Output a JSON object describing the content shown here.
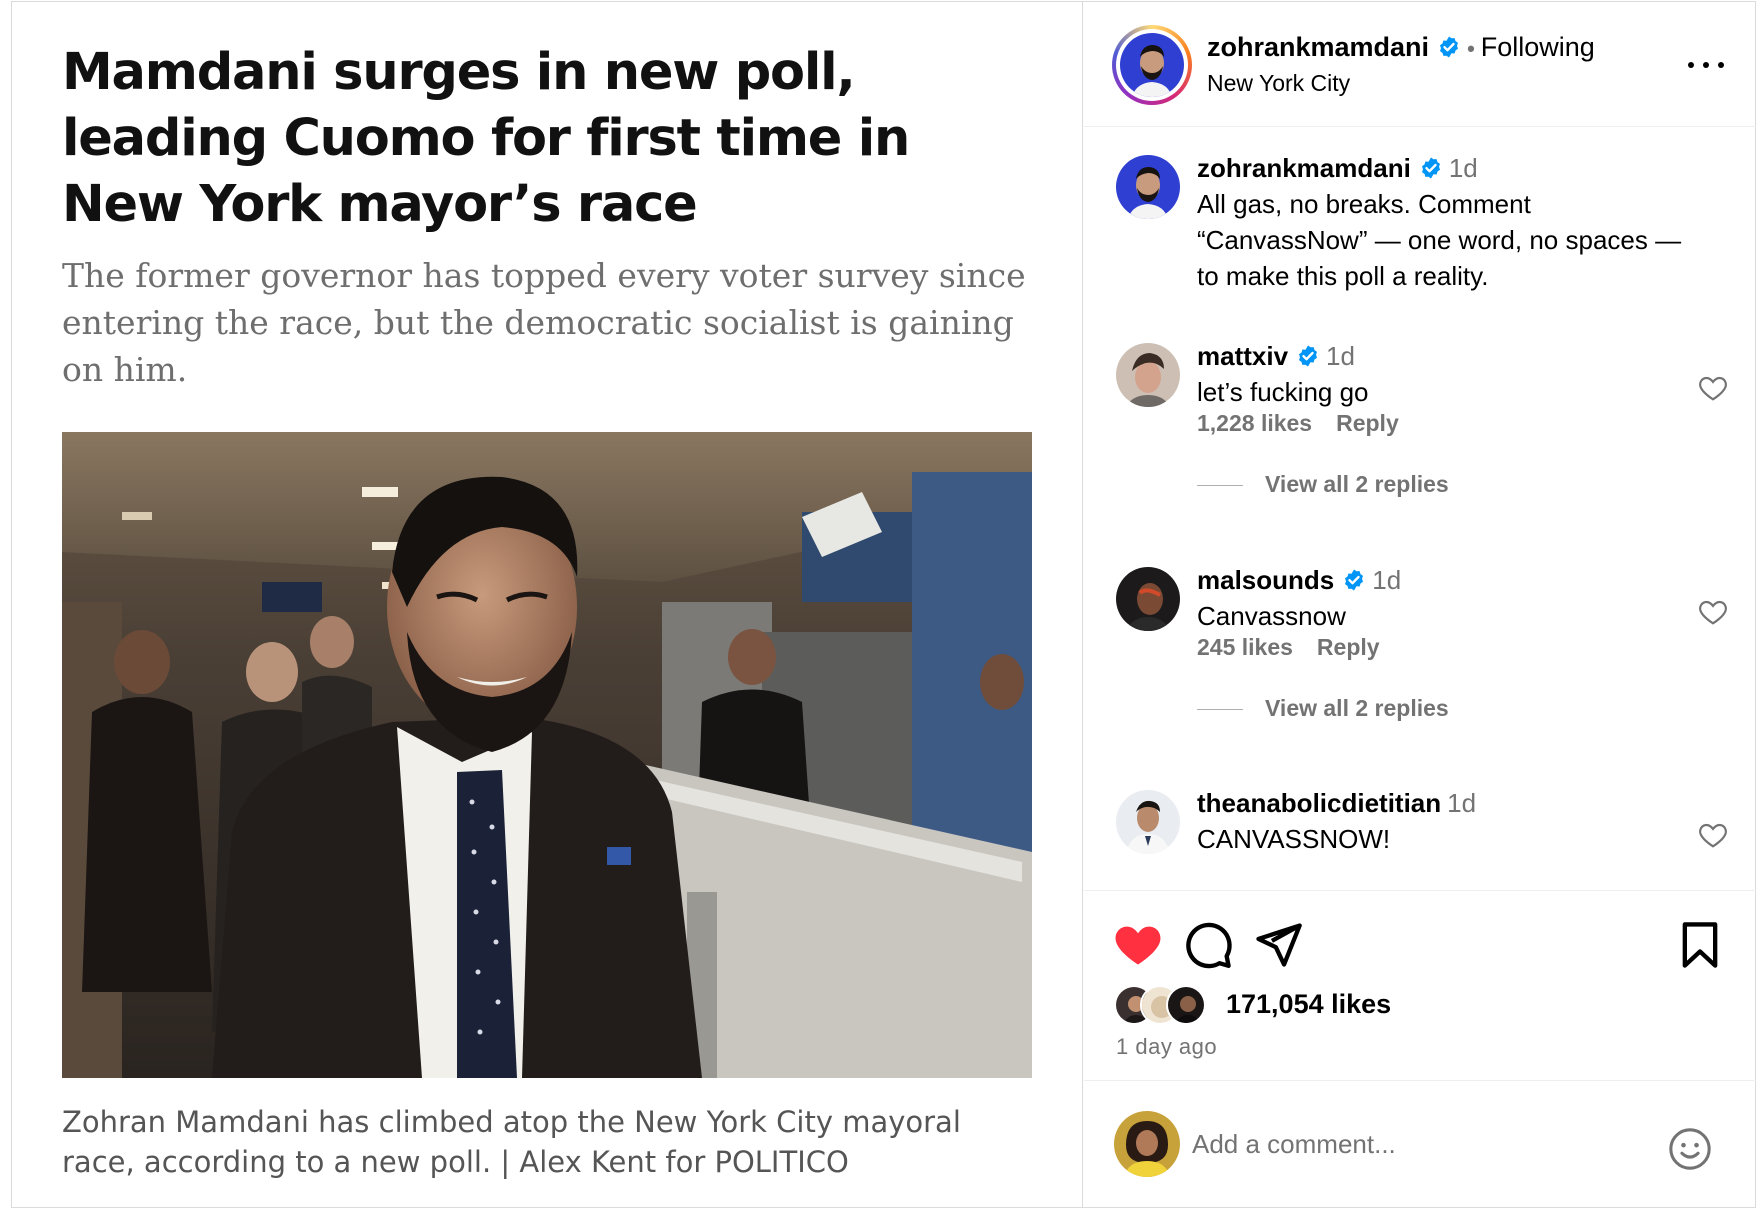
{
  "article": {
    "headline": "Mamdani surges in new poll, leading Cuomo for first time in New York mayor’s race",
    "dek": "The former governor has topped every voter survey since entering the race, but the democratic socialist is gaining on him.",
    "caption": "Zohran Mamdani has climbed atop the New York City mayoral race, according to a new poll. | Alex Kent for POLITICO"
  },
  "header": {
    "username": "zohrankmamdani",
    "separator": "•",
    "follow_label": "Following",
    "location": "New York City"
  },
  "caption_comment": {
    "username": "zohrankmamdani",
    "time": "1d",
    "text": "All gas, no breaks. Comment “CanvassNow” — one word, no spaces — to make this poll a reality."
  },
  "comments": [
    {
      "username": "mattxiv",
      "verified": true,
      "time": "1d",
      "text": "let’s fucking go",
      "likes": "1,228 likes",
      "reply": "Reply",
      "view_replies": "View all 2 replies"
    },
    {
      "username": "malsounds",
      "verified": true,
      "time": "1d",
      "text": "Canvassnow",
      "likes": "245 likes",
      "reply": "Reply",
      "view_replies": "View all 2 replies"
    },
    {
      "username": "theanabolicdietitian",
      "verified": false,
      "time": "1d",
      "text": "CANVASSNOW!"
    }
  ],
  "actions": {
    "likes": "171,054 likes",
    "time_ago": "1 day ago",
    "liked": true
  },
  "add_comment": {
    "placeholder": "Add a comment..."
  },
  "colors": {
    "verified": "#0095f6",
    "like_red": "#ff3040",
    "muted": "#737373"
  },
  "icons": [
    "verified-icon",
    "more-options-icon",
    "heart-icon",
    "comment-icon",
    "share-icon",
    "bookmark-icon",
    "emoji-icon"
  ]
}
